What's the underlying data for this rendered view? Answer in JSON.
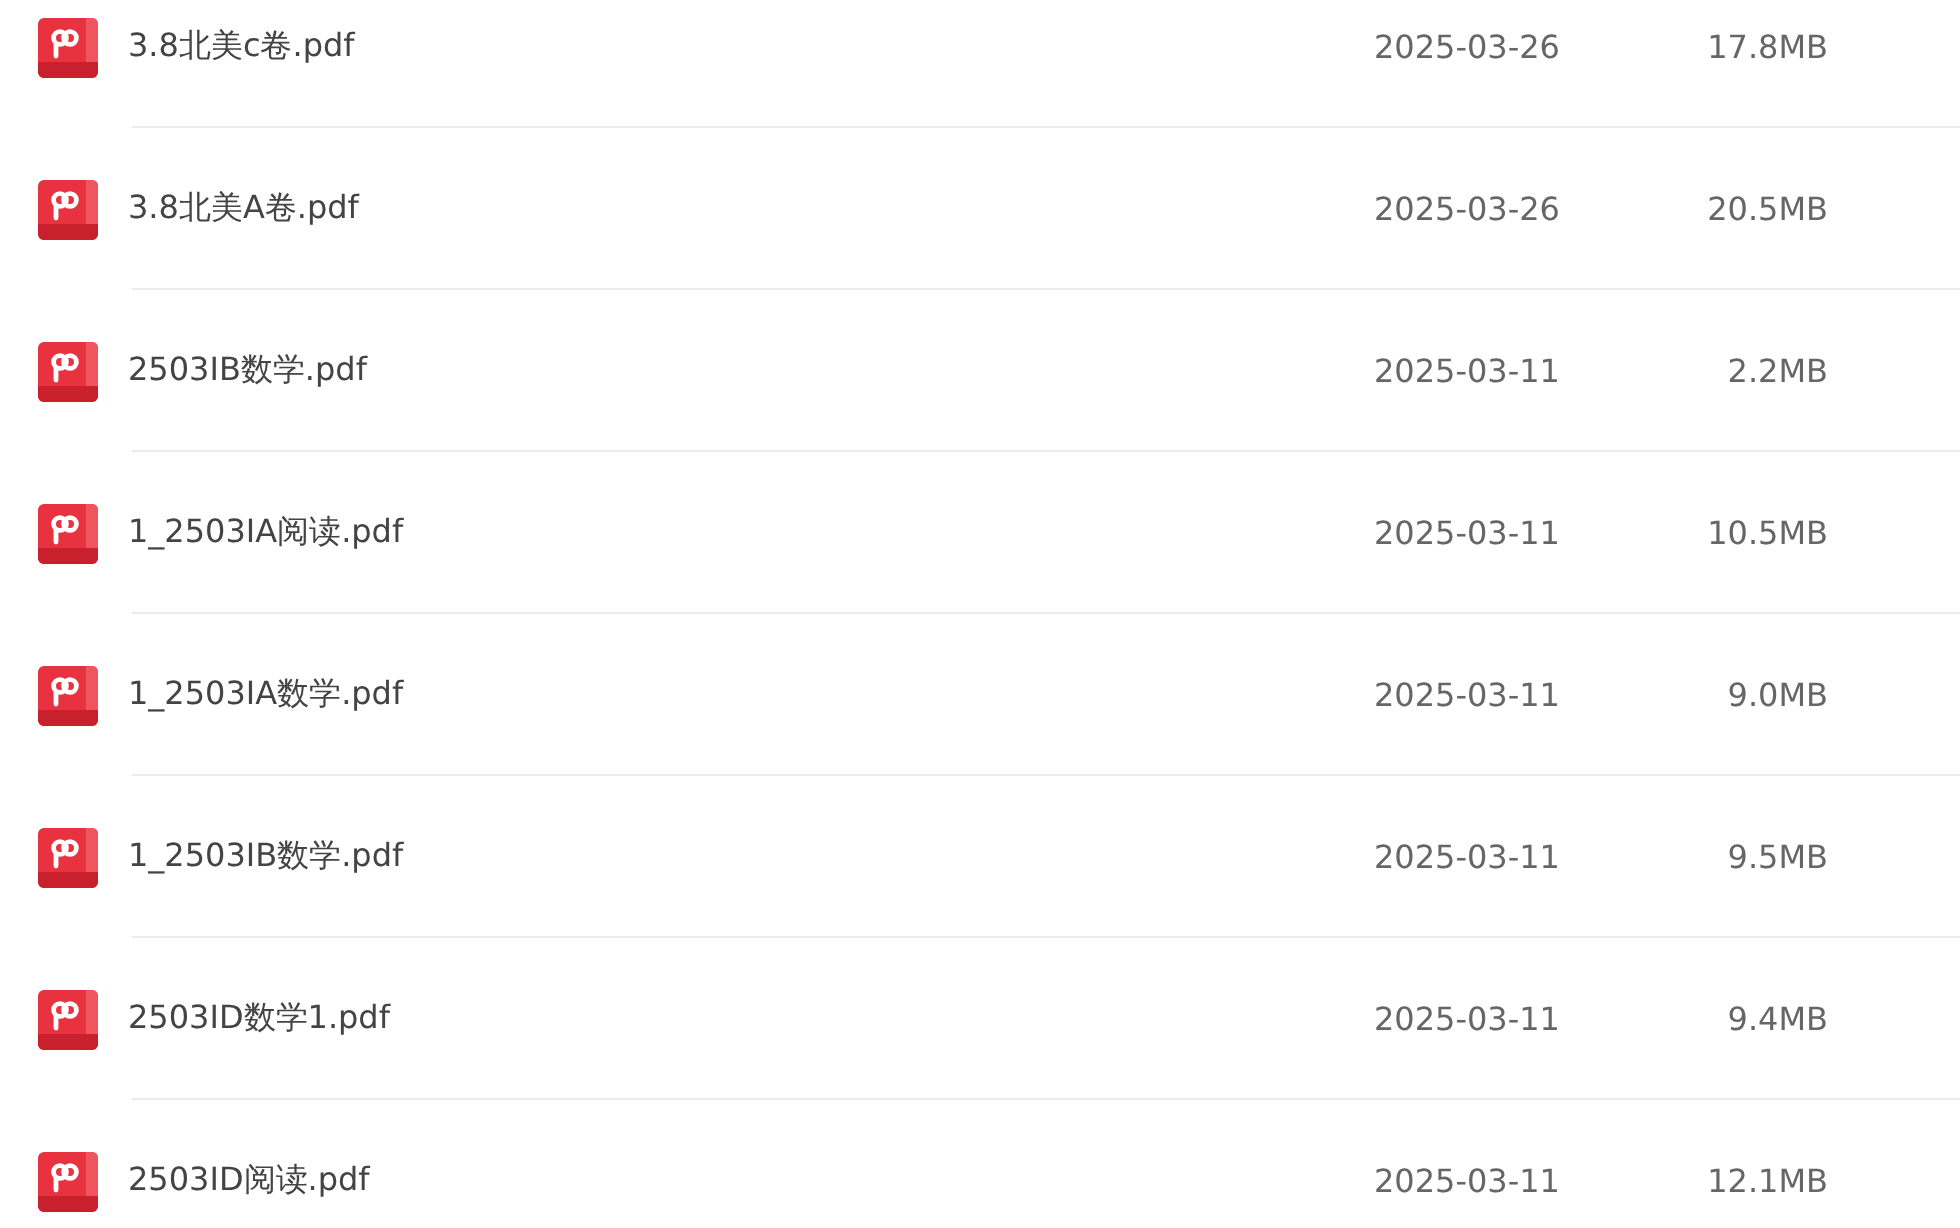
{
  "files": [
    {
      "name": "3.8北美c卷.pdf",
      "date": "2025-03-26",
      "size": "17.8MB"
    },
    {
      "name": "3.8北美A卷.pdf",
      "date": "2025-03-26",
      "size": "20.5MB"
    },
    {
      "name": "2503IB数学.pdf",
      "date": "2025-03-11",
      "size": "2.2MB"
    },
    {
      "name": "1_2503IA阅读.pdf",
      "date": "2025-03-11",
      "size": "10.5MB"
    },
    {
      "name": "1_2503IA数学.pdf",
      "date": "2025-03-11",
      "size": "9.0MB"
    },
    {
      "name": "1_2503IB数学.pdf",
      "date": "2025-03-11",
      "size": "9.5MB"
    },
    {
      "name": "2503ID数学1.pdf",
      "date": "2025-03-11",
      "size": "9.4MB"
    },
    {
      "name": "2503ID阅读.pdf",
      "date": "2025-03-11",
      "size": "12.1MB"
    }
  ]
}
